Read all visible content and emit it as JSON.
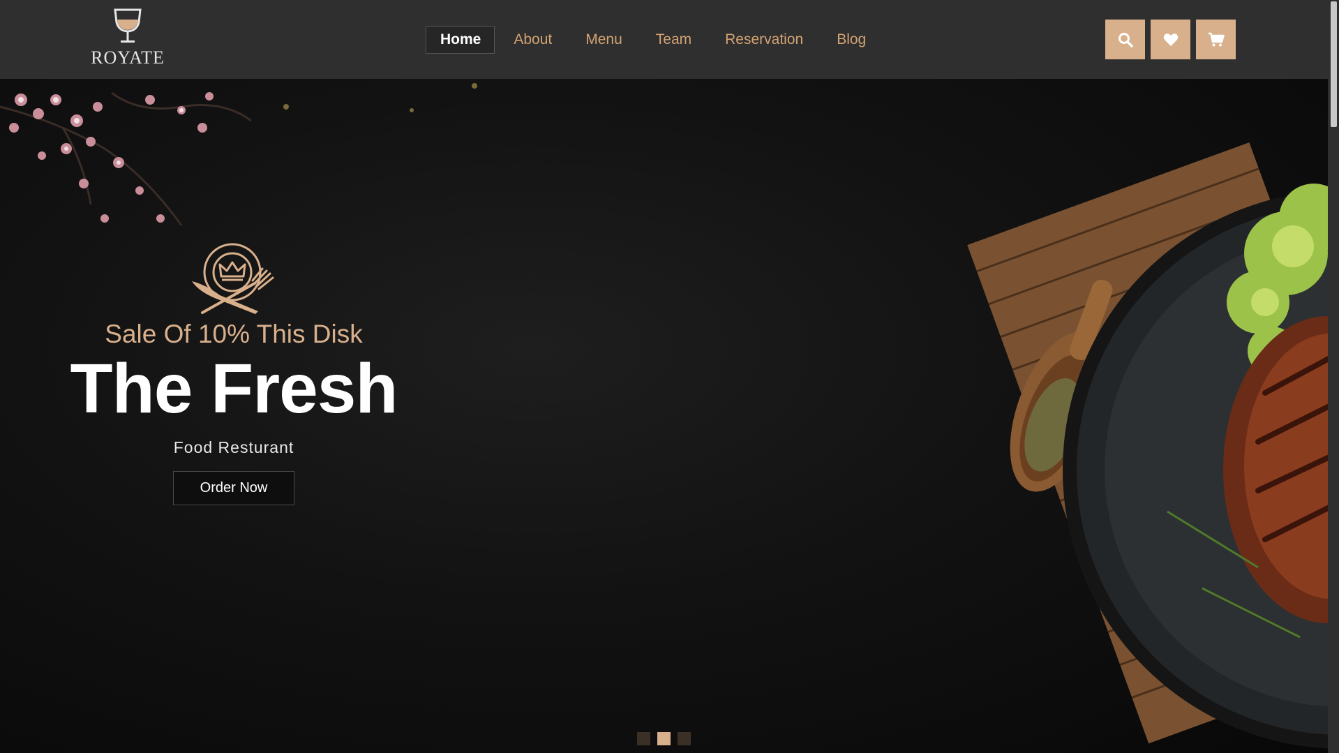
{
  "brand": {
    "name": "ROYATE"
  },
  "nav": {
    "items": [
      {
        "label": "Home",
        "active": true
      },
      {
        "label": "About",
        "active": false
      },
      {
        "label": "Menu",
        "active": false
      },
      {
        "label": "Team",
        "active": false
      },
      {
        "label": "Reservation",
        "active": false
      },
      {
        "label": "Blog",
        "active": false
      }
    ]
  },
  "actions": [
    {
      "icon": "search-icon"
    },
    {
      "icon": "heart-icon"
    },
    {
      "icon": "cart-icon"
    }
  ],
  "hero": {
    "sale": "Sale Of 10% This Disk",
    "title": "The Fresh",
    "subtitle": "Food Resturant",
    "cta": "Order Now"
  },
  "slider": {
    "count": 3,
    "active_index": 1
  },
  "colors": {
    "accent": "#d9b08c",
    "header_bg": "#2f2f2f",
    "hero_bg": "#0c0c0c"
  }
}
